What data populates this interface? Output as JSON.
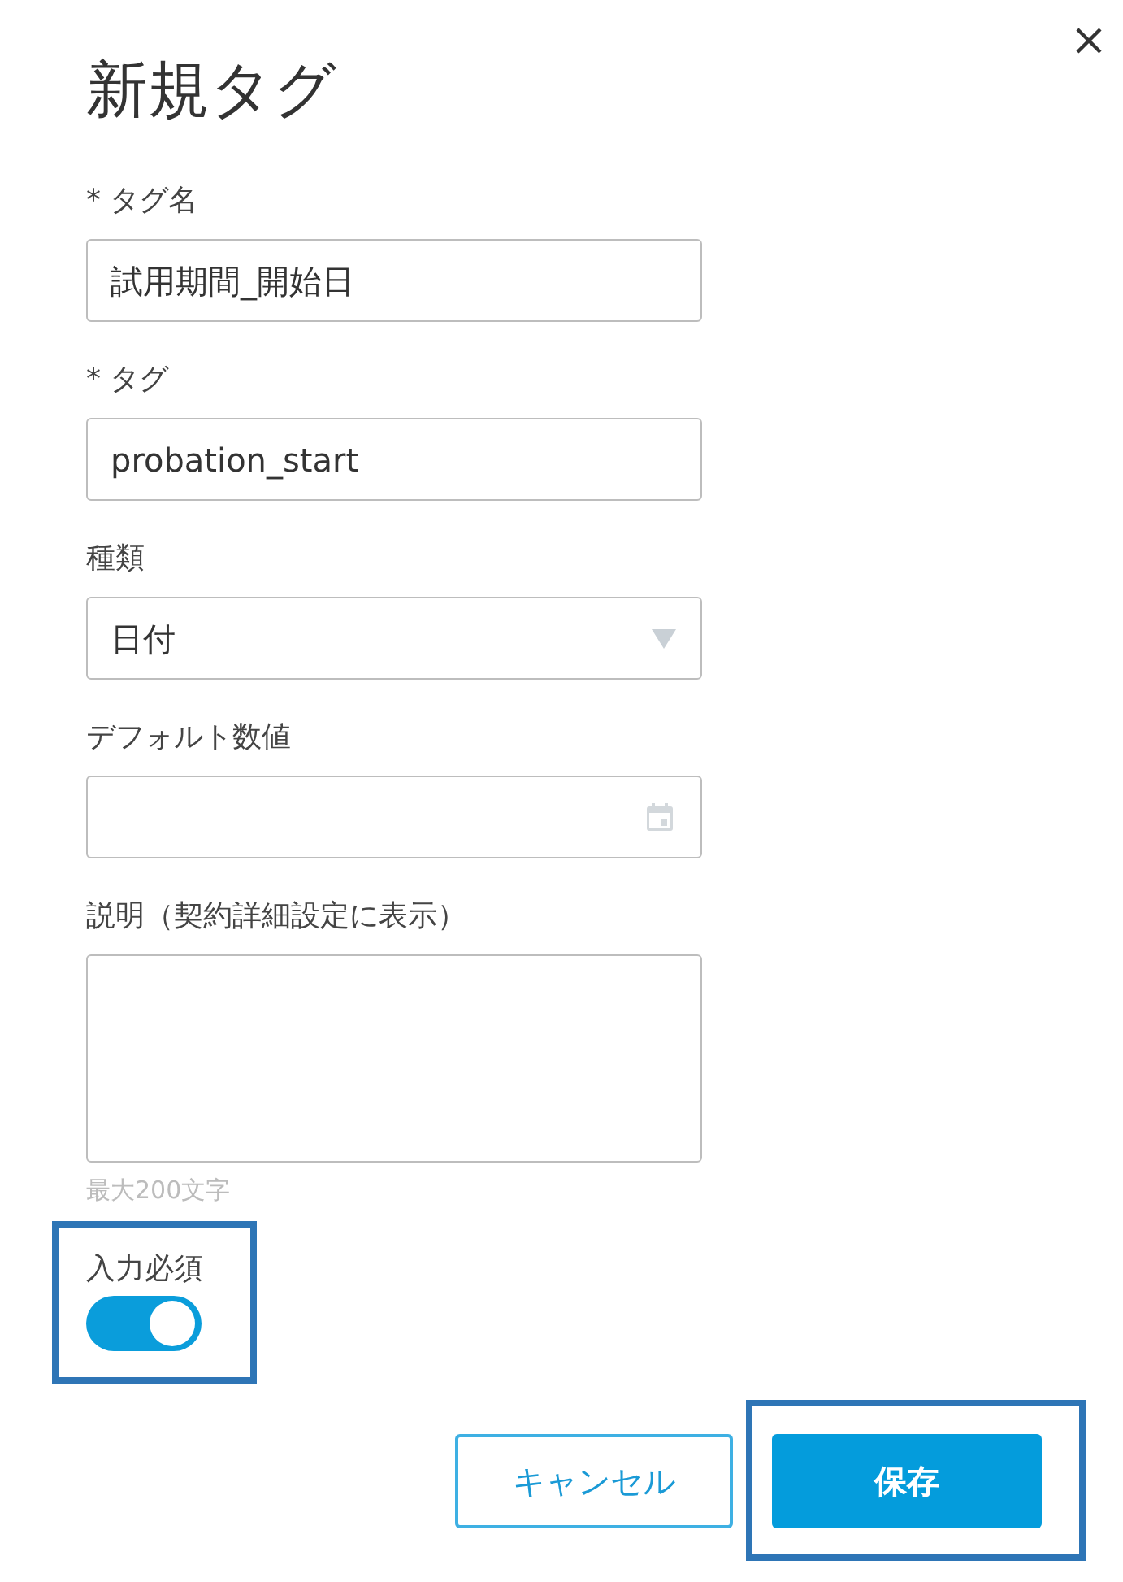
{
  "dialog": {
    "title": "新規タグ"
  },
  "fields": [
    {
      "kind": "text",
      "label": "* タグ名",
      "value": "試用期間_開始日"
    },
    {
      "kind": "text",
      "label": "* タグ",
      "value": "probation_start"
    },
    {
      "kind": "select",
      "label": "種類",
      "value": "日付"
    },
    {
      "kind": "date",
      "label": "デフォルト数値"
    },
    {
      "kind": "textarea",
      "label": "説明（契約詳細設定に表示）",
      "hint": "最大200文字"
    }
  ],
  "required_toggle": {
    "label": "入力必須",
    "on": true,
    "highlighted": true
  },
  "buttons": [
    {
      "kind": "secondary",
      "label": "キャンセル",
      "highlighted": false
    },
    {
      "kind": "primary",
      "label": "保存",
      "highlighted": true
    }
  ]
}
